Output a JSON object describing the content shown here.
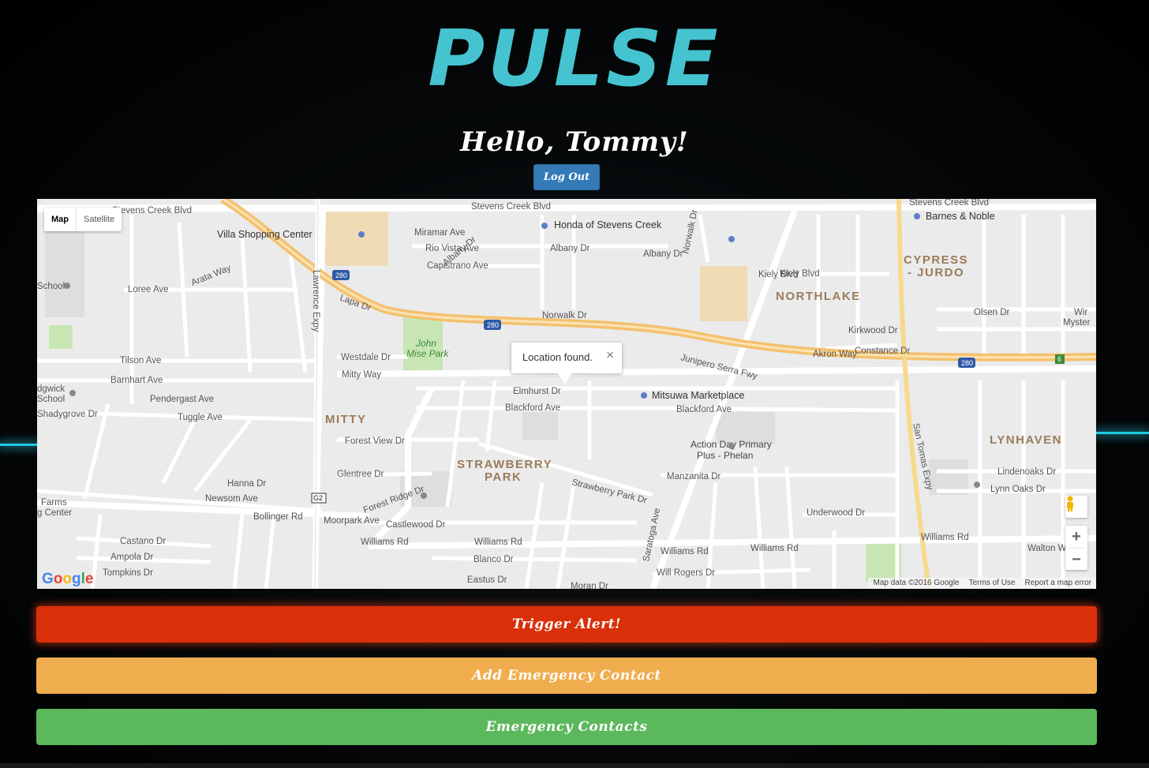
{
  "app": {
    "logo_text": "PULSE",
    "greeting": "Hello, Tommy!",
    "logout_label": "Log Out"
  },
  "map": {
    "type_controls": [
      "Map",
      "Satellite"
    ],
    "popup": {
      "text": "Location found.",
      "close": "×"
    },
    "zoom_in": "+",
    "zoom_out": "−",
    "google_logo": "Google",
    "attribution": [
      "Map data ©2016 Google",
      "Terms of Use",
      "Report a map error"
    ],
    "labels": {
      "stevens_creek_1": "Stevens Creek Blvd",
      "stevens_creek_2": "Stevens Creek Blvd",
      "stevens_creek_3": "Stevens Creek Blvd",
      "honda": "Honda of Stevens Creek",
      "barnes": "Barnes & Noble",
      "villa": "Villa Shopping Center",
      "miramar": "Miramar Ave",
      "rio_vista": "Rio Vista Ave",
      "capistrano": "Capistrano Ave",
      "albany_dr": "Albany Dr",
      "albany_dr2": "Albany Dr",
      "albany_ct": "Albany Dr",
      "kiely_blvd": "Kiely Blvd",
      "kiely_blvd2": "Kiely Blvd",
      "norwalk": "Norwalk Dr",
      "norwalk2": "Norwalk Dr",
      "northlake": "NORTHLAKE",
      "cypress_jurdo": "CYPRESS",
      "cypress_jurdo2": "- JURDO",
      "junipero": "Junipero Serra Fwy",
      "akron": "Akron Way",
      "constance": "Constance Dr",
      "kirkwood": "Kirkwood Dr",
      "olsen": "Olsen Dr",
      "loree": "Loree Ave",
      "arata": "Arata Way",
      "lapa": "Lapa Dr",
      "tilson": "Tilson Ave",
      "barnhart": "Barnhart Ave",
      "pendergast": "Pendergast Ave",
      "tuggle": "Tuggle Ave",
      "shadygrove": "Shadygrove Dr",
      "westdale": "Westdale Dr",
      "mitty_way": "Mitty Way",
      "mitty": "MITTY",
      "john_mise": "John",
      "john_mise2": "Mise Park",
      "elmhurst": "Elmhurst Dr",
      "blackford": "Blackford Ave",
      "blackford2": "Blackford Ave",
      "mitsuwa": "Mitsuwa Marketplace",
      "action_day": "Action Day Primary",
      "action_day2": "Plus - Phelan",
      "forest_view": "Forest View Dr",
      "glentree": "Glentree Dr",
      "forest_ridge": "Forest Ridge Dr",
      "strawberry_park": "STRAWBERRY",
      "strawberry_park2": "PARK",
      "strawberry_park_dr": "Strawberry Park Dr",
      "manzanita": "Manzanita Dr",
      "lynhaven": "LYNHAVEN",
      "lindenoaks": "Lindenoaks Dr",
      "lynn_oaks": "Lynn Oaks Dr",
      "underwood": "Underwood Dr",
      "williams": "Williams Rd",
      "williams2": "Williams Rd",
      "williams3": "Williams Rd",
      "williams4": "Williams Rd",
      "williams5": "Williams Rd",
      "walton": "Walton Way",
      "will_rogers": "Will Rogers Dr",
      "castlewood": "Castlewood Dr",
      "moorpark": "Moorpark Ave",
      "bollinger": "Bollinger Rd",
      "newsom": "Newsom Ave",
      "hanna": "Hanna Dr",
      "castano": "Castano Dr",
      "ampola": "Ampola Dr",
      "tompkins": "Tompkins Dr",
      "blanco": "Blanco Dr",
      "eastus": "Eastus Dr",
      "moran": "Moran Dr",
      "school": "School",
      "dgwick": "dgwick",
      "dgwick2": "School",
      "farms": "Farms",
      "farms2": "g Center",
      "lawrence": "Lawrence Expy",
      "san_tomas": "San Tomas Expy",
      "saratoga": "Saratoga Ave",
      "shield_280": "280",
      "shield_g2": "G2",
      "shield_6": "6",
      "wir": "Wir",
      "myster": "Myster"
    }
  },
  "buttons": {
    "trigger_alert": "Trigger Alert!",
    "add_contact": "Add Emergency Contact",
    "contacts": "Emergency Contacts"
  },
  "colors": {
    "logo": "#45c3d1",
    "alert": "#d9300a",
    "add_contact": "#f0ad4e",
    "contacts": "#5cb85c",
    "logout": "#337ab7"
  }
}
